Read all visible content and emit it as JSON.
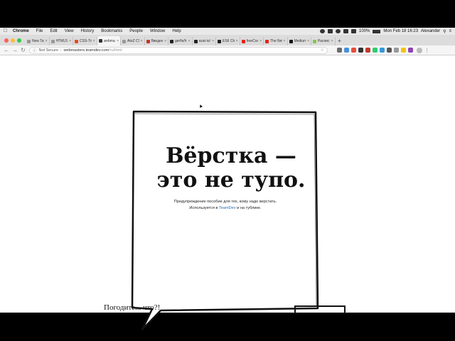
{
  "menubar": {
    "app_name": "Chrome",
    "items": [
      "File",
      "Edit",
      "View",
      "History",
      "Bookmarks",
      "People",
      "Window",
      "Help"
    ],
    "battery": "100%",
    "clock": "Mon Feb 18  16:23",
    "user": "Alexander"
  },
  "tabs": [
    {
      "label": "New Tab",
      "favicon_color": "#999999"
    },
    {
      "label": "HTML5…",
      "favicon_color": "#999999"
    },
    {
      "label": "CSS-Tri…",
      "favicon_color": "#e34c26"
    },
    {
      "label": "webmas…",
      "favicon_color": "#333333",
      "active": true
    },
    {
      "label": "AtoZ CS…",
      "favicon_color": "#999999"
    },
    {
      "label": "Введени…",
      "favicon_color": "#c0392b"
    },
    {
      "label": "gerfis/h…",
      "favicon_color": "#222222"
    },
    {
      "label": "azat-io/…",
      "favicon_color": "#222222"
    },
    {
      "label": "ES6 Chi…",
      "favicon_color": "#222222"
    },
    {
      "label": "freeCod…",
      "favicon_color": "#e62117"
    },
    {
      "label": "The Net…",
      "favicon_color": "#e62117"
    },
    {
      "label": "Medium",
      "favicon_color": "#111111"
    },
    {
      "label": "Распис…",
      "favicon_color": "#8bc34a"
    }
  ],
  "toolbar": {
    "security_label": "Not Secure",
    "url_host": "webmasters.teamdev.com",
    "url_path": "/ru/html"
  },
  "colors": {
    "link": "#2a6fb0",
    "traffic_close": "#fc605c",
    "traffic_min": "#fdbc40",
    "traffic_max": "#34c84a"
  },
  "hero": {
    "title_line1": "Вёрстка —",
    "title_line2": "это не тупо.",
    "subtitle_line1": "Предупреждение пособие для тех, кому надо верстать.",
    "subtitle_prefix": "Используется в ",
    "subtitle_link": "TeamDev",
    "subtitle_suffix": " и на тублике."
  },
  "section": {
    "heading": "Погодите... что?!"
  }
}
